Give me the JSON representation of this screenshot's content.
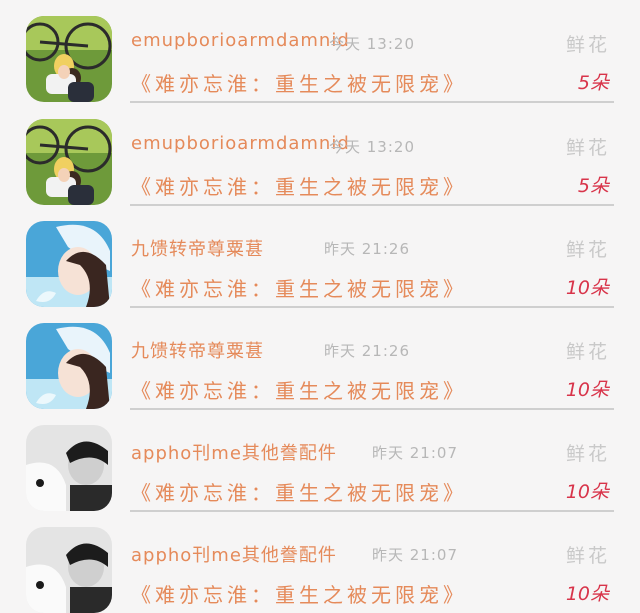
{
  "items": [
    {
      "name": "emupborioarmdamnid",
      "time": "今天  13:20",
      "gift_label": "鲜花",
      "work": "《难亦忘淮：重生之被无限宠》",
      "count": "5朵",
      "avatar": "couple-bicycle-photo"
    },
    {
      "name": "emupborioarmdamnid",
      "time": "今天  13:20",
      "gift_label": "鲜花",
      "work": "《难亦忘淮：重生之被无限宠》",
      "count": "5朵",
      "avatar": "couple-bicycle-photo"
    },
    {
      "name": "九馈转帝尊粟葚",
      "time": "昨天  21:26",
      "gift_label": "鲜花",
      "work": "《难亦忘淮：重生之被无限宠》",
      "count": "10朵",
      "avatar": "anime-girl-sky-photo"
    },
    {
      "name": "九馈转帝尊粟葚",
      "time": "昨天  21:26",
      "gift_label": "鲜花",
      "work": "《难亦忘淮：重生之被无限宠》",
      "count": "10朵",
      "avatar": "anime-girl-sky-photo"
    },
    {
      "name": "appho刊me其他誊配件",
      "time": "昨天  21:07",
      "gift_label": "鲜花",
      "work": "《难亦忘淮：重生之被无限宠》",
      "count": "10朵",
      "avatar": "bw-man-pillow-photo"
    },
    {
      "name": "appho刊me其他誊配件",
      "time": "昨天  21:07",
      "gift_label": "鲜花",
      "work": "《难亦忘淮：重生之被无限宠》",
      "count": "10朵",
      "avatar": "bw-man-pillow-photo"
    }
  ],
  "colors": {
    "accent_orange": "#e58a5a",
    "count_red": "#d8344a",
    "muted_gray": "#b7b7b7",
    "divider": "#cfcfcf",
    "background": "#f6f5f5"
  }
}
